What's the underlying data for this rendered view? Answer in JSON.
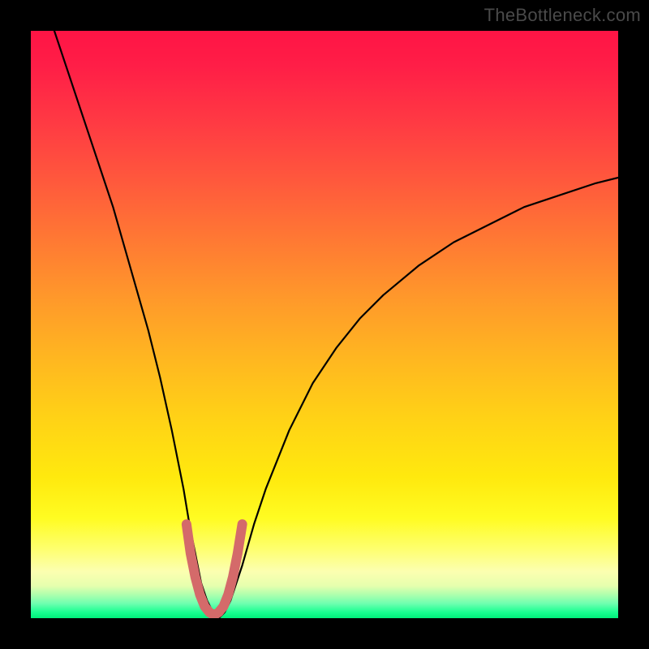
{
  "watermark": "TheBottleneck.com",
  "chart_data": {
    "type": "line",
    "title": "",
    "xlabel": "",
    "ylabel": "",
    "xlim": [
      0,
      100
    ],
    "ylim": [
      0,
      100
    ],
    "grid": false,
    "legend": false,
    "annotations": [],
    "series": [
      {
        "name": "bottleneck-curve",
        "stroke": "#000000",
        "stroke_width": 2.2,
        "x": [
          4,
          6,
          8,
          10,
          12,
          14,
          16,
          18,
          20,
          22,
          24,
          26,
          27,
          28,
          29,
          30,
          31,
          32,
          33,
          34,
          36,
          38,
          40,
          44,
          48,
          52,
          56,
          60,
          66,
          72,
          78,
          84,
          90,
          96,
          100
        ],
        "y": [
          100,
          94,
          88,
          82,
          76,
          70,
          63,
          56,
          49,
          41,
          32,
          22,
          16,
          11,
          6,
          3,
          1,
          0,
          1,
          3,
          9,
          16,
          22,
          32,
          40,
          46,
          51,
          55,
          60,
          64,
          67,
          70,
          72,
          74,
          75
        ]
      },
      {
        "name": "optimal-marker",
        "stroke": "#d46a6a",
        "stroke_width": 12,
        "x": [
          26.5,
          27.2,
          28.0,
          28.8,
          29.6,
          30.4,
          31.2,
          32.0,
          32.8,
          33.6,
          34.4,
          35.2,
          36.0
        ],
        "y": [
          16.0,
          11.0,
          7.0,
          4.0,
          2.0,
          1.0,
          0.5,
          1.0,
          2.0,
          4.0,
          7.0,
          11.0,
          16.0
        ]
      }
    ],
    "gradient_background": {
      "direction": "vertical",
      "stops": [
        {
          "pos": 0.0,
          "color": "#ff1445"
        },
        {
          "pos": 0.5,
          "color": "#ffb720"
        },
        {
          "pos": 0.8,
          "color": "#fffc22"
        },
        {
          "pos": 0.95,
          "color": "#aeffad"
        },
        {
          "pos": 1.0,
          "color": "#00f07a"
        }
      ]
    }
  }
}
